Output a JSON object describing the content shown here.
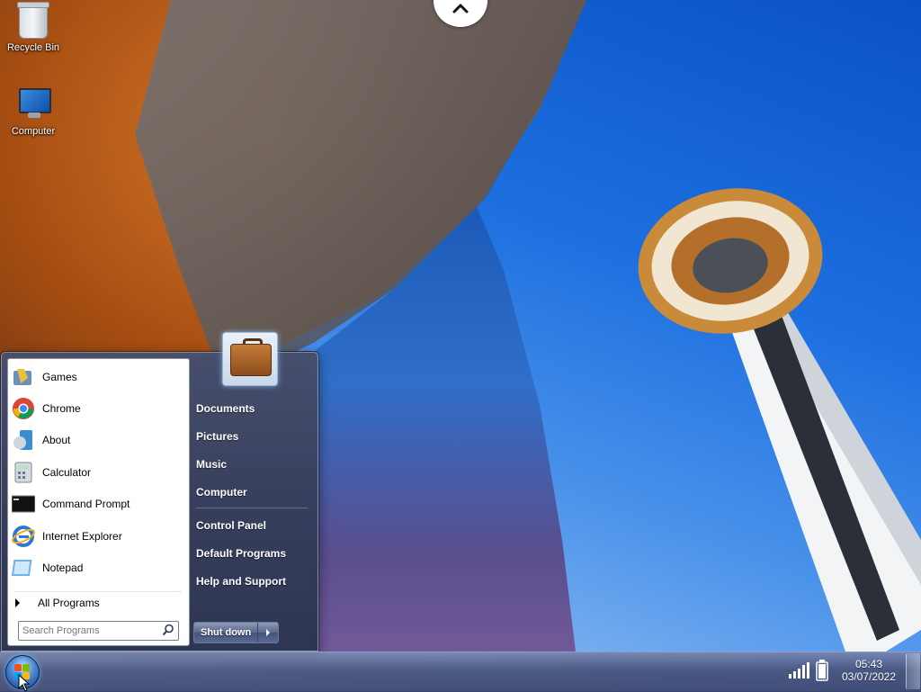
{
  "desktop": {
    "icons": [
      {
        "label": "Recycle Bin",
        "icon": "recycle-bin-icon"
      },
      {
        "label": "Computer",
        "icon": "computer-icon"
      }
    ]
  },
  "start_menu": {
    "programs": [
      {
        "label": "Games",
        "icon": "games-icon"
      },
      {
        "label": "Chrome",
        "icon": "chrome-icon"
      },
      {
        "label": "About",
        "icon": "about-icon"
      },
      {
        "label": "Calculator",
        "icon": "calculator-icon"
      },
      {
        "label": "Command Prompt",
        "icon": "command-prompt-icon"
      },
      {
        "label": "Internet Explorer",
        "icon": "internet-explorer-icon"
      },
      {
        "label": "Notepad",
        "icon": "notepad-icon"
      }
    ],
    "all_programs_label": "All Programs",
    "search_placeholder": "Search Programs",
    "right_links": [
      "Documents",
      "Pictures",
      "Music",
      "Computer",
      "Control Panel",
      "Default Programs",
      "Help and Support"
    ],
    "shutdown_label": "Shut down"
  },
  "taskbar": {
    "time": "05:43",
    "date": "03/07/2022"
  }
}
